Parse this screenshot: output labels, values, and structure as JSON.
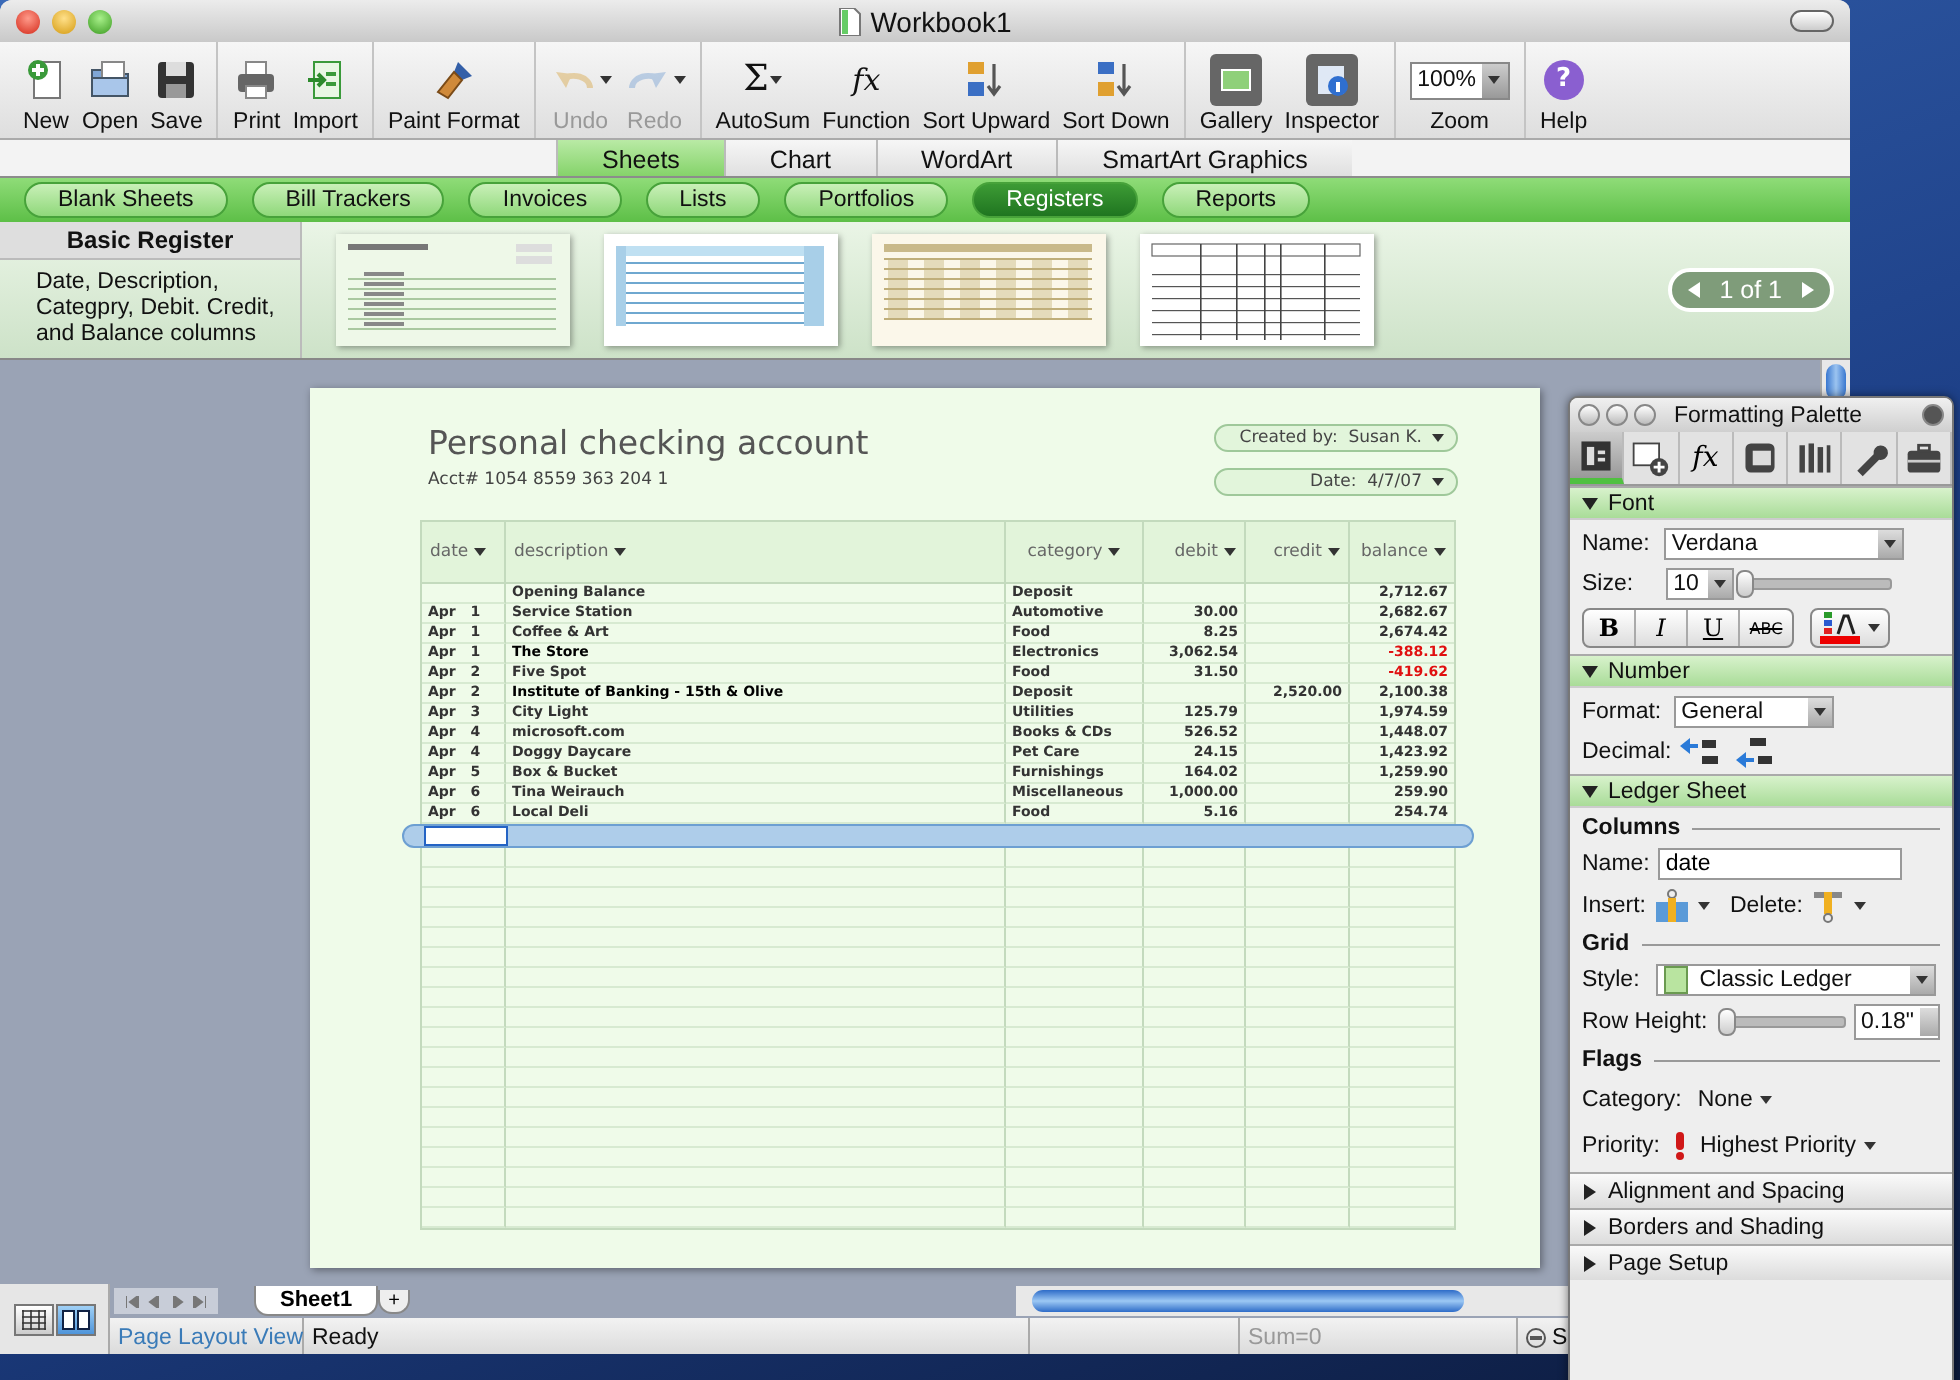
{
  "window": {
    "title": "Workbook1"
  },
  "toolbar": {
    "groups": [
      [
        {
          "kind": "new",
          "label": "New",
          "disabled": false,
          "on": false,
          "menu": false
        },
        {
          "kind": "open",
          "label": "Open",
          "disabled": false,
          "on": false,
          "menu": false
        },
        {
          "kind": "save",
          "label": "Save",
          "disabled": false,
          "on": false,
          "menu": false
        }
      ],
      [
        {
          "kind": "print",
          "label": "Print",
          "disabled": false,
          "on": false,
          "menu": false
        },
        {
          "kind": "import",
          "label": "Import",
          "disabled": false,
          "on": false,
          "menu": false
        }
      ],
      [
        {
          "kind": "paint",
          "label": "Paint Format",
          "disabled": false,
          "on": false,
          "menu": false
        }
      ],
      [
        {
          "kind": "undo",
          "label": "Undo",
          "disabled": true,
          "on": false,
          "menu": true
        },
        {
          "kind": "redo",
          "label": "Redo",
          "disabled": true,
          "on": false,
          "menu": true
        }
      ],
      [
        {
          "kind": "sum",
          "label": "AutoSum",
          "glyph": "Σ",
          "disabled": false,
          "on": false,
          "menu": true
        },
        {
          "kind": "function",
          "label": "Function",
          "glyph": "fx",
          "disabled": false,
          "on": false,
          "menu": false
        },
        {
          "kind": "sort-up",
          "label": "Sort Upward",
          "disabled": false,
          "on": false,
          "menu": false
        },
        {
          "kind": "sort-down",
          "label": "Sort Down",
          "disabled": false,
          "on": false,
          "menu": false
        }
      ],
      [
        {
          "kind": "gallery",
          "label": "Gallery",
          "disabled": false,
          "on": true,
          "menu": false
        },
        {
          "kind": "inspector",
          "label": "Inspector",
          "disabled": false,
          "on": true,
          "menu": false
        }
      ],
      [
        {
          "kind": "zoom",
          "label": "Zoom",
          "value": "100%",
          "disabled": false,
          "on": false,
          "menu": true
        }
      ],
      [
        {
          "kind": "help",
          "label": "Help",
          "glyph": "?",
          "disabled": false,
          "on": false,
          "menu": false
        }
      ]
    ]
  },
  "ribbon_tabs": [
    {
      "label": "Sheets",
      "selected": true
    },
    {
      "label": "Chart",
      "selected": false
    },
    {
      "label": "WordArt",
      "selected": false
    },
    {
      "label": "SmartArt Graphics",
      "selected": false
    }
  ],
  "categories": [
    {
      "label": "Blank Sheets",
      "selected": false
    },
    {
      "label": "Bill Trackers",
      "selected": false
    },
    {
      "label": "Invoices",
      "selected": false
    },
    {
      "label": "Lists",
      "selected": false
    },
    {
      "label": "Portfolios",
      "selected": false
    },
    {
      "label": "Registers",
      "selected": true
    },
    {
      "label": "Reports",
      "selected": false
    }
  ],
  "gallery": {
    "title": "Basic Register",
    "description": "Date, Description, Categpry, Debit. Credit, and Balance columns",
    "templates": [
      {
        "kind": "green-ledger"
      },
      {
        "kind": "blue-grid"
      },
      {
        "kind": "tan-grid"
      },
      {
        "kind": "plain-grid"
      }
    ],
    "pager": "1 of 1"
  },
  "sheet": {
    "title": "Personal checking account",
    "account": "Acct# 1054 8559 363 204 1",
    "created_by": "Created by:  Susan K.",
    "date": "Date:  4/7/07",
    "columns": [
      {
        "label": "date"
      },
      {
        "label": "description"
      },
      {
        "label": "category"
      },
      {
        "label": "debit"
      },
      {
        "label": "credit"
      },
      {
        "label": "balance"
      }
    ],
    "rows": [
      {
        "description": "Opening Balance",
        "category": "Deposit",
        "balance": "2,712.67",
        "emphasis": false,
        "negative": false
      },
      {
        "date": "Apr   1",
        "description": "Service Station",
        "category": "Automotive",
        "debit": "30.00",
        "balance": "2,682.67",
        "emphasis": false,
        "negative": false
      },
      {
        "date": "Apr   1",
        "description": "Coffee & Art",
        "category": "Food",
        "debit": "8.25",
        "balance": "2,674.42",
        "emphasis": false,
        "negative": false
      },
      {
        "date": "Apr   1",
        "description": "The Store",
        "category": "Electronics",
        "debit": "3,062.54",
        "balance": "-388.12",
        "emphasis": true,
        "negative": true
      },
      {
        "date": "Apr   2",
        "description": "Five Spot",
        "category": "Food",
        "debit": "31.50",
        "balance": "-419.62",
        "emphasis": false,
        "negative": true
      },
      {
        "date": "Apr   2",
        "description": "Institute of Banking - 15th & Olive",
        "category": "Deposit",
        "credit": "2,520.00",
        "balance": "2,100.38",
        "emphasis": true,
        "negative": false
      },
      {
        "date": "Apr   3",
        "description": "City Light",
        "category": "Utilities",
        "debit": "125.79",
        "balance": "1,974.59",
        "emphasis": false,
        "negative": false
      },
      {
        "date": "Apr   4",
        "description": "microsoft.com",
        "category": "Books & CDs",
        "debit": "526.52",
        "balance": "1,448.07",
        "emphasis": false,
        "negative": false
      },
      {
        "date": "Apr   4",
        "description": "Doggy Daycare",
        "category": "Pet Care",
        "debit": "24.15",
        "balance": "1,423.92",
        "emphasis": false,
        "negative": false
      },
      {
        "date": "Apr   5",
        "description": "Box & Bucket",
        "category": "Furnishings",
        "debit": "164.02",
        "balance": "1,259.90",
        "emphasis": false,
        "negative": false
      },
      {
        "date": "Apr   6",
        "description": "Tina Weirauch",
        "category": "Miscellaneous",
        "debit": "1,000.00",
        "balance": "259.90",
        "emphasis": false,
        "negative": false
      },
      {
        "date": "Apr   6",
        "description": "Local Deli",
        "category": "Food",
        "debit": "5.16",
        "balance": "254.74",
        "emphasis": false,
        "negative": false
      }
    ]
  },
  "bottom": {
    "views": [
      {
        "kind": "normal",
        "selected": false
      },
      {
        "kind": "page-layout",
        "selected": true
      }
    ],
    "sheet_tabs": [
      {
        "label": "Sheet1",
        "selected": true
      }
    ],
    "add_tab": "+",
    "status": {
      "view": "Page Layout View",
      "state": "Ready",
      "sum": "Sum=0",
      "mode": "S"
    }
  },
  "palette": {
    "title": "Formatting Palette",
    "tools": [
      {
        "kind": "text",
        "selected": true
      },
      {
        "kind": "objects",
        "selected": false
      },
      {
        "kind": "formula",
        "glyph": "fx",
        "selected": false
      },
      {
        "kind": "scrapbook",
        "selected": false
      },
      {
        "kind": "reference",
        "selected": false
      },
      {
        "kind": "toolbox",
        "selected": false
      },
      {
        "kind": "project",
        "selected": false
      }
    ],
    "sections": [
      {
        "kind": "font",
        "title": "Font",
        "expanded": true,
        "name_label": "Name:",
        "name": "Verdana",
        "size_label": "Size:",
        "size": "10",
        "size_slider": {
          "level": 0
        },
        "styles": [
          {
            "label": "B",
            "kind": "bold"
          },
          {
            "label": "I",
            "kind": "italic"
          },
          {
            "label": "U",
            "kind": "underline"
          },
          {
            "label": "ABC",
            "kind": "strike"
          }
        ]
      },
      {
        "kind": "number",
        "title": "Number",
        "expanded": true,
        "format_label": "Format:",
        "format": "General",
        "decimal_label": "Decimal:"
      },
      {
        "kind": "ledger",
        "title": "Ledger Sheet",
        "expanded": true,
        "columns_heading": "Columns",
        "name_label": "Name:",
        "name": "date",
        "insert_label": "Insert:",
        "delete_label": "Delete:",
        "grid_heading": "Grid",
        "style_label": "Style:",
        "style": "Classic Ledger",
        "row_height_label": "Row Height:",
        "row_height_slider": {
          "level": 0
        },
        "row_height": "0.18\"",
        "flags_heading": "Flags",
        "category_label": "Category:",
        "category": "None",
        "priority_label": "Priority:",
        "priority": "Highest Priority"
      },
      {
        "kind": "plain",
        "title": "Alignment and Spacing",
        "expanded": false
      },
      {
        "kind": "plain",
        "title": "Borders and Shading",
        "expanded": false
      },
      {
        "kind": "plain",
        "title": "Page Setup",
        "expanded": false
      }
    ]
  }
}
